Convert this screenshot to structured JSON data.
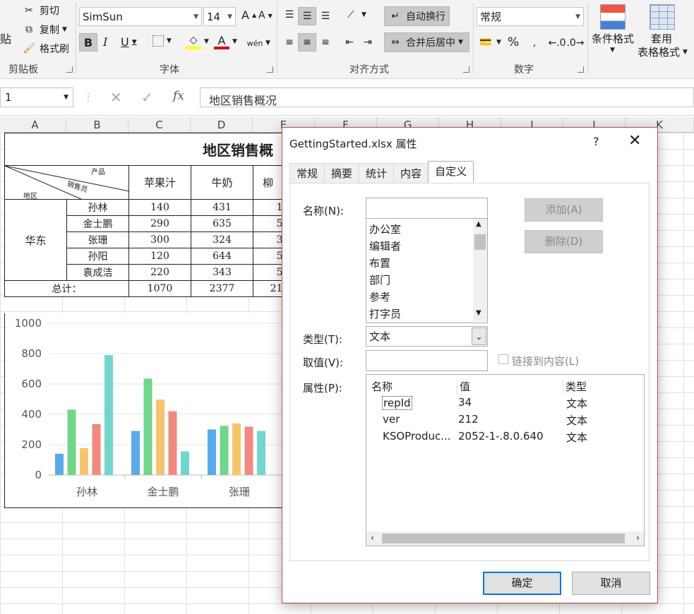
{
  "ribbon": {
    "clipboard": {
      "paste_partial": "贴",
      "cut": "剪切",
      "copy": "复制",
      "format_painter": "格式刷",
      "group_label": "剪贴板"
    },
    "font": {
      "name": "SimSun",
      "size": "14",
      "bold": "B",
      "italic": "I",
      "underline": "U",
      "grow": "A",
      "shrink": "A",
      "color_letter": "A",
      "group_label": "字体"
    },
    "alignment": {
      "wrap": "自动换行",
      "merge": "合并后居中",
      "group_label": "对齐方式"
    },
    "number": {
      "format": "常规",
      "percent": "%",
      "group_label": "数字"
    },
    "styles": {
      "conditional": "条件格式",
      "table_format_1": "套用",
      "table_format_2": "表格格式"
    }
  },
  "formula_bar": {
    "name_box": "1",
    "fx": "fx",
    "content": "地区销售概况"
  },
  "columns": [
    "A",
    "B",
    "C",
    "D",
    "E",
    "F",
    "G",
    "H",
    "I",
    "J",
    "K"
  ],
  "sheet": {
    "title": "地区销售概",
    "corner_product": "产品",
    "corner_seller": "销售员",
    "corner_region": "地区",
    "headers": [
      "苹果汁",
      "牛奶",
      "柳"
    ],
    "region": "华东",
    "rows": [
      {
        "name": "孙林",
        "c": "140",
        "d": "431",
        "e": "1"
      },
      {
        "name": "金士鹏",
        "c": "290",
        "d": "635",
        "e": "5"
      },
      {
        "name": "张珊",
        "c": "300",
        "d": "324",
        "e": "3"
      },
      {
        "name": "孙阳",
        "c": "120",
        "d": "644",
        "e": "5"
      },
      {
        "name": "袁成洁",
        "c": "220",
        "d": "343",
        "e": "5"
      }
    ],
    "total_label": "总计：",
    "totals": {
      "c": "1070",
      "d": "2377",
      "e": "21"
    }
  },
  "chart_data": {
    "type": "bar",
    "categories": [
      "孙林",
      "金士鹏",
      "张珊"
    ],
    "series": [
      {
        "color": "#5aaae9",
        "values": [
          140,
          290,
          300
        ]
      },
      {
        "color": "#72d58b",
        "values": [
          431,
          635,
          324
        ]
      },
      {
        "color": "#f5c56e",
        "values": [
          177,
          497,
          340
        ]
      },
      {
        "color": "#f08a80",
        "values": [
          335,
          420,
          318
        ]
      },
      {
        "color": "#72d6cc",
        "values": [
          790,
          155,
          290
        ]
      }
    ],
    "yticks": [
      "0",
      "200",
      "400",
      "600",
      "800",
      "1000"
    ],
    "ylim": [
      0,
      1000
    ]
  },
  "dialog": {
    "title": "GettingStarted.xlsx 属性",
    "help": "?",
    "tabs": [
      "常规",
      "摘要",
      "统计",
      "内容",
      "自定义"
    ],
    "name_label": "名称(N):",
    "name_value": "",
    "add_button": "添加(A)",
    "delete_button": "删除(D)",
    "name_options": [
      "办公室",
      "编辑者",
      "布置",
      "部门",
      "参考",
      "打字员"
    ],
    "type_label": "类型(T):",
    "type_value": "文本",
    "value_label": "取值(V):",
    "link_label": "链接到内容(L)",
    "properties_label": "属性(P):",
    "prop_headers": [
      "名称",
      "值",
      "类型"
    ],
    "properties": [
      {
        "name": "repId",
        "value": "34",
        "type": "文本"
      },
      {
        "name": "ver",
        "value": "212",
        "type": "文本"
      },
      {
        "name": "KSOProduc...",
        "value": "2052-1-.8.0.640",
        "type": "文本"
      }
    ],
    "ok": "确定",
    "cancel": "取消"
  }
}
